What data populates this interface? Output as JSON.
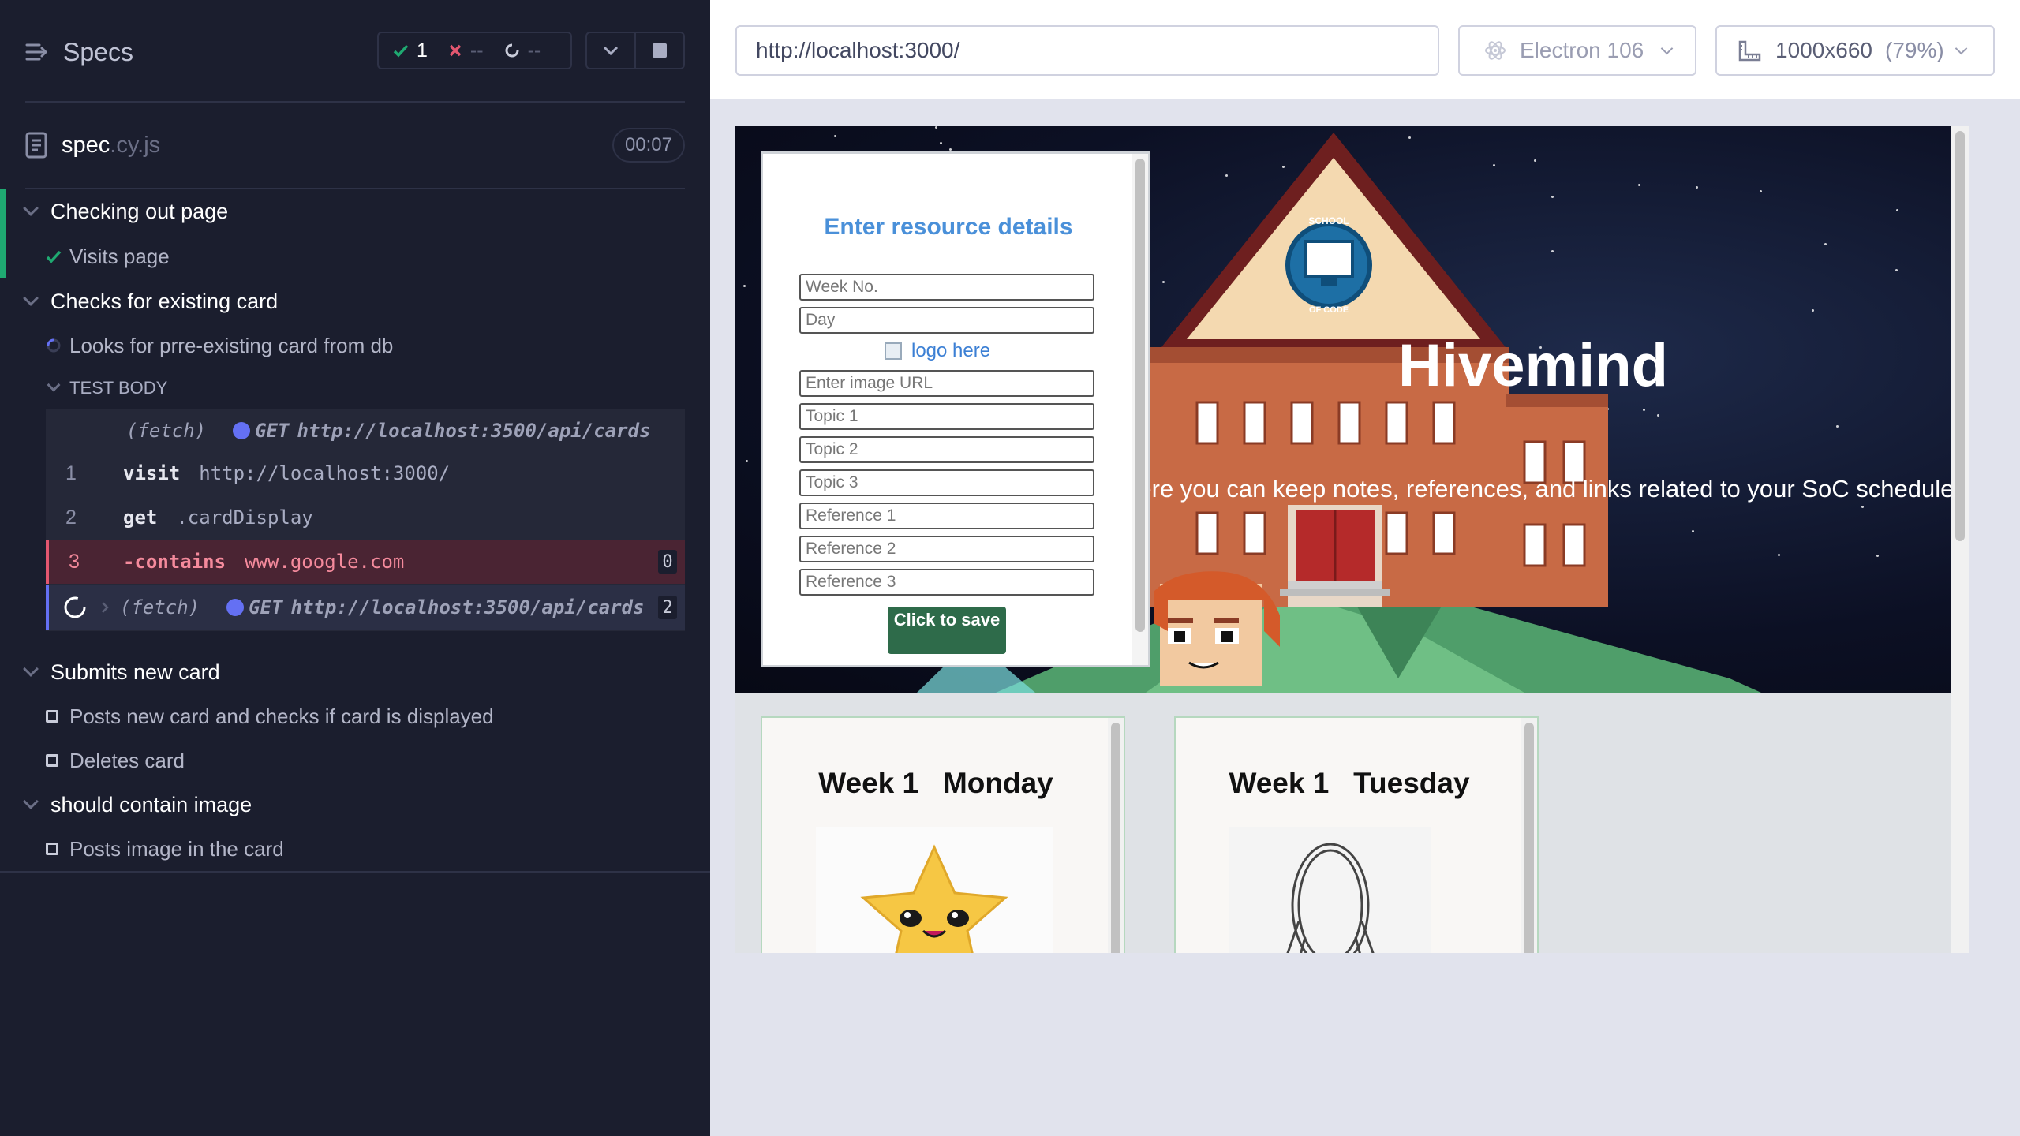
{
  "reporter": {
    "header": {
      "title": "Specs",
      "passed": "1",
      "failed": "--",
      "pending": "--"
    },
    "spec": {
      "name": "spec",
      "ext": ".cy.js",
      "duration": "00:07"
    },
    "suites": [
      {
        "title": "Checking out page",
        "tests": [
          {
            "title": "Visits page",
            "state": "passed"
          }
        ]
      },
      {
        "title": "Checks for existing card",
        "tests": [
          {
            "title": "Looks for prre-existing card from db",
            "state": "running"
          }
        ]
      },
      {
        "title": "Submits new card",
        "tests": [
          {
            "title": "Posts new card and checks if card is displayed",
            "state": "pending"
          },
          {
            "title": "Deletes card",
            "state": "pending"
          }
        ]
      },
      {
        "title": "should contain image",
        "tests": [
          {
            "title": "Posts image in the card",
            "state": "pending"
          }
        ]
      }
    ],
    "test_body_label": "TEST BODY",
    "commands": [
      {
        "num": "",
        "name": "(fetch)",
        "method": "GET",
        "arg": "http://localhost:3500/api/cards"
      },
      {
        "num": "1",
        "name": "visit",
        "arg": "http://localhost:3000/"
      },
      {
        "num": "2",
        "name": "get",
        "arg": ".cardDisplay"
      },
      {
        "num": "3",
        "name": "-contains",
        "arg": "www.google.com",
        "badge": "0"
      },
      {
        "num": "",
        "name": "(fetch)",
        "method": "GET",
        "arg": "http://localhost:3500/api/cards",
        "badge": "2"
      }
    ]
  },
  "aut": {
    "url": "http://localhost:3000/",
    "browser": "Electron 106",
    "viewport": "1000x660",
    "scale": "(79%)"
  },
  "app": {
    "title": "Hivemind",
    "tagline": "Here you can keep notes, references, and links related to your SoC schedule.",
    "badge_top": "SCHOOL",
    "badge_bottom": "OF CODE",
    "form": {
      "title": "Enter resource details",
      "week_placeholder": "Week No.",
      "day_placeholder": "Day",
      "logo_alt": "logo here",
      "image_placeholder": "Enter image URL",
      "topic1": "Topic 1",
      "topic2": "Topic 2",
      "topic3": "Topic 3",
      "ref1": "Reference 1",
      "ref2": "Reference 2",
      "ref3": "Reference 3",
      "save_label": "Click to save"
    },
    "cards": [
      {
        "week": "Week 1",
        "day": "Monday"
      },
      {
        "week": "Week 1",
        "day": "Tuesday"
      }
    ]
  },
  "colors": {
    "pass": "#1fa971",
    "fail": "#e45770",
    "running": "#6470f3",
    "reporter_bg": "#1b1e2e"
  }
}
